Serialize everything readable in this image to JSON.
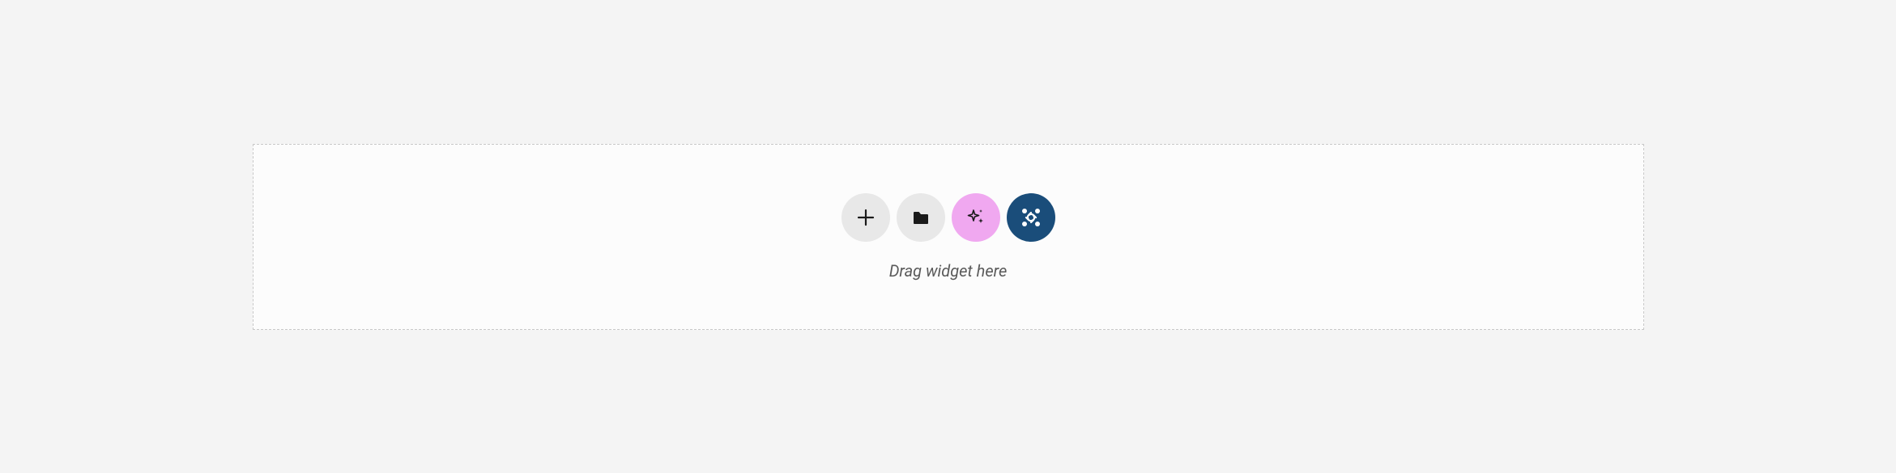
{
  "dropzone": {
    "hint": "Drag widget here",
    "buttons": {
      "add": {
        "bg": "#e8e8e8",
        "icon_color": "#1a1a1a"
      },
      "folder": {
        "bg": "#e8e8e8",
        "icon_color": "#1a1a1a"
      },
      "sparkle": {
        "bg": "#f0a8f0",
        "icon_color": "#1a1a1a"
      },
      "joomla": {
        "bg": "#1a4d7a",
        "icon_color": "#ffffff"
      }
    }
  }
}
